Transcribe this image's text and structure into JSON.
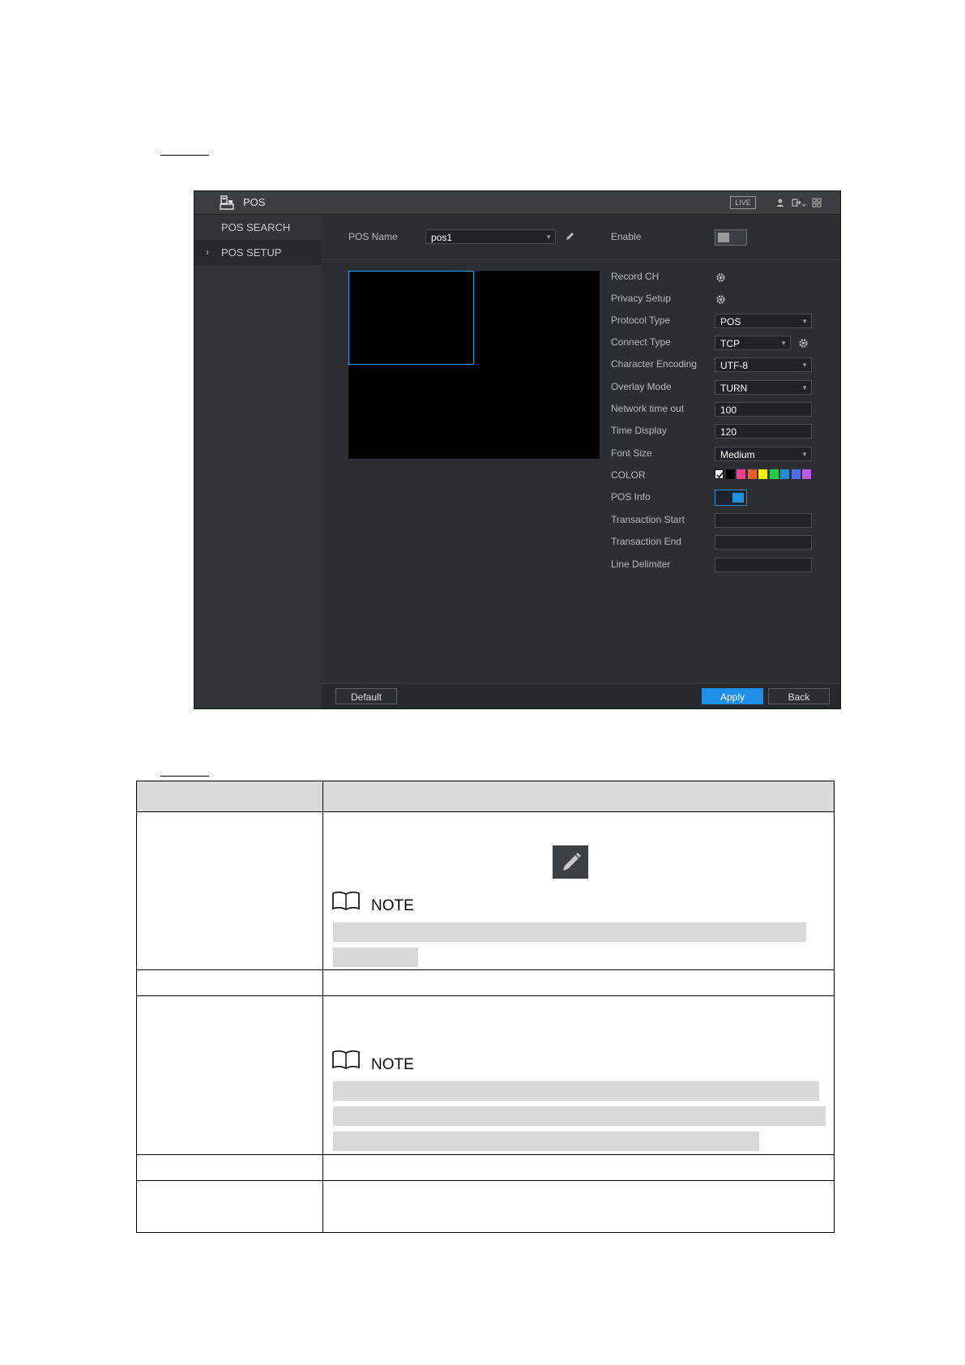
{
  "window": {
    "title": "POS",
    "live_label": "LIVE"
  },
  "sidebar": {
    "items": [
      {
        "label": "POS SEARCH"
      },
      {
        "label": "POS SETUP",
        "chevron": "›"
      }
    ]
  },
  "form": {
    "pos_name_label": "POS Name",
    "pos_name_value": "pos1",
    "enable_label": "Enable",
    "enable_on": false,
    "rows": [
      {
        "label": "Record CH"
      },
      {
        "label": "Privacy Setup"
      },
      {
        "label": "Protocol Type",
        "value": "POS"
      },
      {
        "label": "Connect Type",
        "value": "TCP"
      },
      {
        "label": "Character Encoding",
        "value": "UTF-8"
      },
      {
        "label": "Overlay Mode",
        "value": "TURN"
      },
      {
        "label": "Network time out",
        "value": "100"
      },
      {
        "label": "Time Display",
        "value": "120"
      },
      {
        "label": "Font Size",
        "value": "Medium"
      },
      {
        "label": "COLOR"
      },
      {
        "label": "POS Info"
      },
      {
        "label": "Transaction Start",
        "value": ""
      },
      {
        "label": "Transaction End",
        "value": ""
      },
      {
        "label": "Line Delimiter",
        "value": ""
      }
    ],
    "pos_info_on": true,
    "colors": [
      "#ffffff",
      "#000000",
      "#ff3d8b",
      "#ff5a1f",
      "#ffee00",
      "#22cc44",
      "#1e8fe6",
      "#4a6cf0",
      "#b85cf0"
    ],
    "colors_selected_index": 0
  },
  "footer": {
    "default_label": "Default",
    "apply_label": "Apply",
    "back_label": "Back"
  },
  "doc": {
    "note_label_1": "NOTE",
    "note_label_2": "NOTE"
  },
  "accent_color": "#1e8fe6"
}
